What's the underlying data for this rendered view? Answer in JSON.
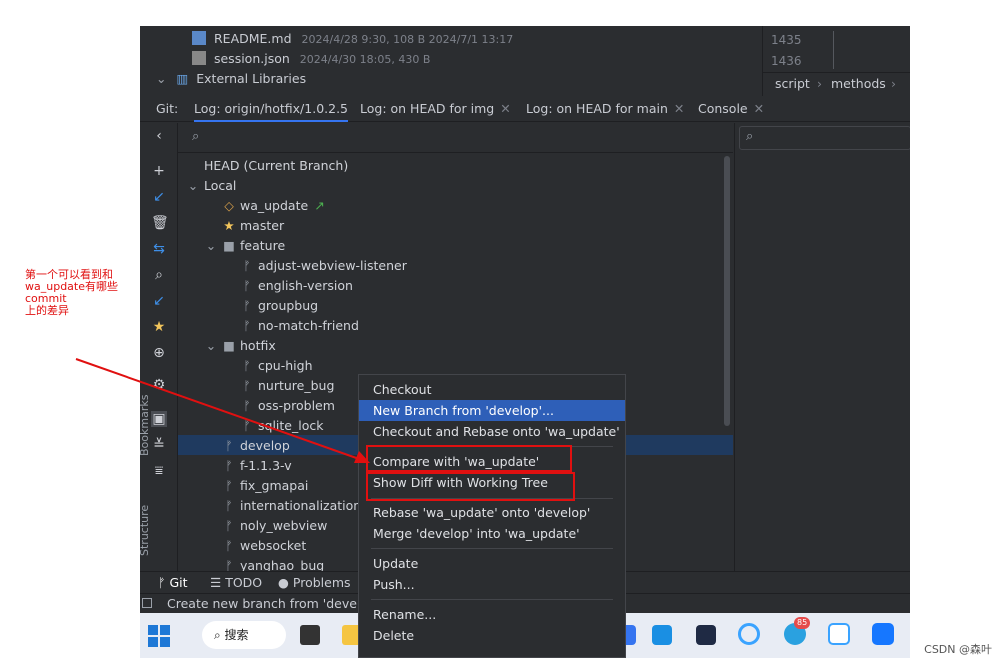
{
  "project": {
    "files": [
      {
        "name": "README.md",
        "meta": "2024/4/28 9:30, 108 B 2024/7/1 13:17"
      },
      {
        "name": "session.json",
        "meta": "2024/4/30 18:05, 430 B"
      }
    ],
    "external_libraries": "External Libraries"
  },
  "right_top": {
    "line_numbers": [
      "1435",
      "1436"
    ],
    "breadcrumb": [
      "script",
      "methods"
    ]
  },
  "git_tabs": {
    "label": "Git:",
    "tabs": [
      {
        "label": "Log: origin/hotfix/1.0.2.5"
      },
      {
        "label": "Log: on HEAD for img"
      },
      {
        "label": "Log: on HEAD for main"
      },
      {
        "label": "Console"
      }
    ]
  },
  "branches": {
    "head": "HEAD (Current Branch)",
    "local": "Local",
    "wa_update": "wa_update",
    "master": "master",
    "feature": "feature",
    "feature_items": [
      "adjust-webview-listener",
      "english-version",
      "groupbug",
      "no-match-friend"
    ],
    "hotfix": "hotfix",
    "hotfix_items": [
      "cpu-high",
      "nurture_bug",
      "oss-problem",
      "sqlite_lock"
    ],
    "others": [
      "develop",
      "f-1.1.3-v",
      "fix_gmapai",
      "internationalization",
      "noly_webview",
      "websocket",
      "yanghao_bug"
    ]
  },
  "context_menu": {
    "items": [
      "Checkout",
      "New Branch from 'develop'...",
      "Checkout and Rebase onto 'wa_update'",
      "Compare with 'wa_update'",
      "Show Diff with Working Tree",
      "Rebase 'wa_update' onto 'develop'",
      "Merge 'develop' into 'wa_update'",
      "Update",
      "Push...",
      "Rename...",
      "Delete"
    ]
  },
  "bottom_tools": {
    "git": "Git",
    "todo": "TODO",
    "problems": "Problems"
  },
  "side_labels": {
    "bookmarks": "Bookmarks",
    "structure": "Structure"
  },
  "status_text": "Create new branch from 'develop",
  "taskbar": {
    "search": "搜索",
    "badge": "85"
  },
  "annotation": {
    "lines": [
      "第一个可以看到和",
      "wa_update有哪些commit",
      "上的差异"
    ]
  },
  "watermark": "CSDN @森叶",
  "colors": {
    "ide_bg": "#2b2d30",
    "selection": "#2e5fb8",
    "accent": "#3574f0",
    "annotation": "#e01010"
  }
}
